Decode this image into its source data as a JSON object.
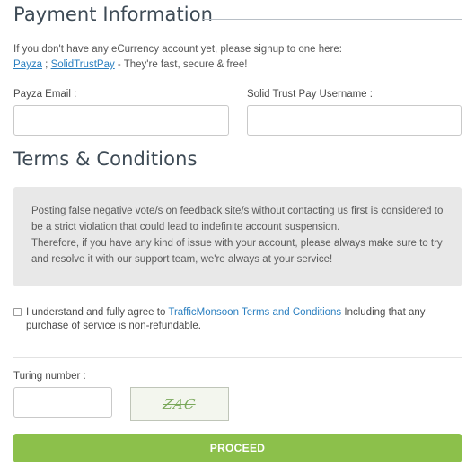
{
  "payment": {
    "title": "Payment Information",
    "intro_line1": "If you don't have any eCurrency account yet, please signup to one here:",
    "link_payza": "Payza",
    "separator": " ; ",
    "link_stp": "SolidTrustPay",
    "intro_suffix": " - They're fast, secure & free!",
    "payza_label": "Payza Email :",
    "payza_value": "",
    "stp_label": "Solid Trust Pay Username :",
    "stp_value": ""
  },
  "terms": {
    "title": "Terms & Conditions",
    "line1": "Posting false negative vote/s on feedback site/s without contacting us first is considered to",
    "line2": "be a strict violation that could lead to indefinite account suspension.",
    "line3": "Therefore, if you have any kind of issue with your account, please always make sure to try",
    "line4": "and resolve it with our support team, we're always at your service!",
    "agree_prefix": "I understand and fully agree to ",
    "agree_link": "TrafficMonsoon Terms and Conditions",
    "agree_suffix": " Including that any purchase of service is non-refundable.",
    "agree_checked": false
  },
  "turing": {
    "label": "Turing number :",
    "value": "",
    "captcha_text": "ZAC"
  },
  "proceed_label": "PROCEED",
  "colors": {
    "link": "#2a7fc0",
    "proceed_bg": "#8cc04b",
    "terms_bg": "#e8e8e8"
  }
}
